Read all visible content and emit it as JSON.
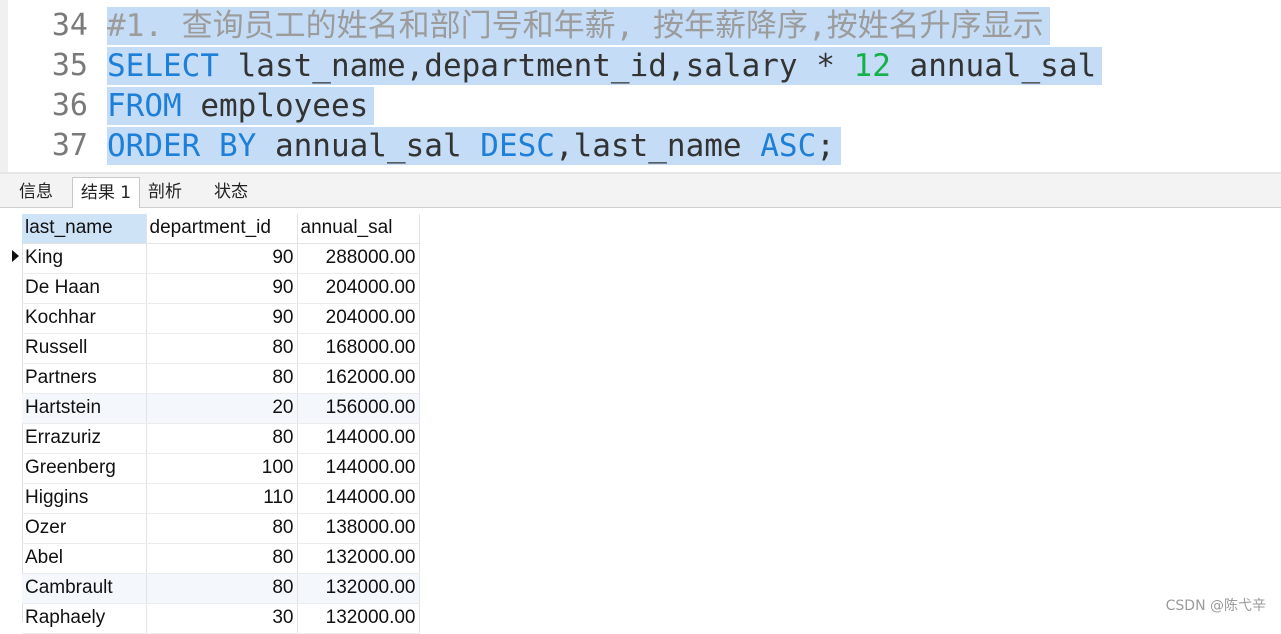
{
  "editor": {
    "lines": [
      {
        "num": "34",
        "comment": "#1. 查询员工的姓名和部门号和年薪, 按年薪降序,按姓名升序显示"
      },
      {
        "num": "35",
        "kw1": "SELECT",
        "t1": " last_name,department_id,salary * ",
        "n1": "12",
        "t2": " annual_sal"
      },
      {
        "num": "36",
        "kw1": "FROM",
        "t1": " employees"
      },
      {
        "num": "37",
        "kw1": "ORDER BY",
        "t1": " annual_sal ",
        "kw2": "DESC",
        "t2": ",last_name ",
        "kw3": "ASC",
        "t3": ";"
      }
    ]
  },
  "tabs": [
    "信息",
    "结果 1",
    "剖析",
    "状态"
  ],
  "active_tab": "结果 1",
  "results": {
    "columns": [
      "last_name",
      "department_id",
      "annual_sal"
    ],
    "rows": [
      [
        "King",
        "90",
        "288000.00"
      ],
      [
        "De Haan",
        "90",
        "204000.00"
      ],
      [
        "Kochhar",
        "90",
        "204000.00"
      ],
      [
        "Russell",
        "80",
        "168000.00"
      ],
      [
        "Partners",
        "80",
        "162000.00"
      ],
      [
        "Hartstein",
        "20",
        "156000.00"
      ],
      [
        "Errazuriz",
        "80",
        "144000.00"
      ],
      [
        "Greenberg",
        "100",
        "144000.00"
      ],
      [
        "Higgins",
        "110",
        "144000.00"
      ],
      [
        "Ozer",
        "80",
        "138000.00"
      ],
      [
        "Abel",
        "80",
        "132000.00"
      ],
      [
        "Cambrault",
        "80",
        "132000.00"
      ],
      [
        "Raphaely",
        "30",
        "132000.00"
      ]
    ]
  },
  "watermark": "CSDN @陈弋辛",
  "colors": {
    "keyword": "#1e7fd8",
    "number": "#14b04a",
    "selection": "#c4dcf6",
    "comment": "#9c9c9c"
  }
}
